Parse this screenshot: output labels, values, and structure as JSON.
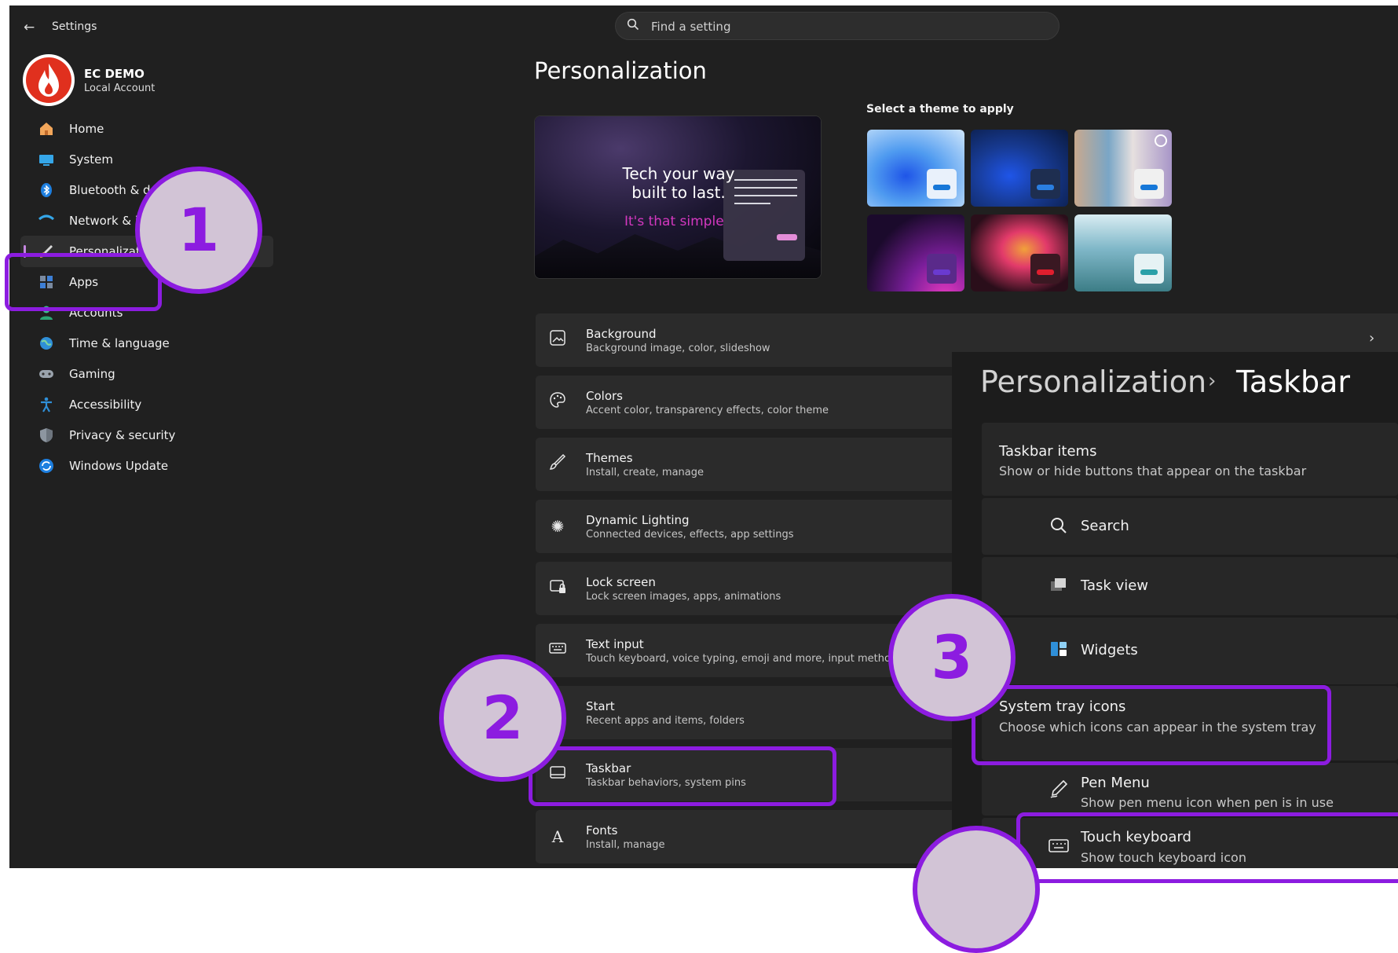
{
  "app": {
    "title": "Settings"
  },
  "search": {
    "placeholder": "Find a setting"
  },
  "account": {
    "name": "EC DEMO",
    "type": "Local Account"
  },
  "sidebar": {
    "items": [
      {
        "label": "Home",
        "icon": "home-icon"
      },
      {
        "label": "System",
        "icon": "display-icon"
      },
      {
        "label": "Bluetooth & d",
        "icon": "bluetooth-icon"
      },
      {
        "label": "Network & inte",
        "icon": "wifi-icon"
      },
      {
        "label": "Personalization",
        "icon": "brush-icon",
        "active": true
      },
      {
        "label": "Apps",
        "icon": "apps-icon"
      },
      {
        "label": "Accounts",
        "icon": "person-icon"
      },
      {
        "label": "Time & language",
        "icon": "globe-clock-icon"
      },
      {
        "label": "Gaming",
        "icon": "gamepad-icon"
      },
      {
        "label": "Accessibility",
        "icon": "accessibility-icon"
      },
      {
        "label": "Privacy & security",
        "icon": "shield-icon"
      },
      {
        "label": "Windows Update",
        "icon": "update-icon"
      }
    ]
  },
  "main": {
    "title": "Personalization",
    "preview": {
      "line1": "Tech your way",
      "line2": "built to last.",
      "line3": "It's that simple"
    },
    "themes_label": "Select a theme to apply",
    "settings": [
      {
        "title": "Background",
        "subtitle": "Background image, color, slideshow",
        "icon": "image-icon"
      },
      {
        "title": "Colors",
        "subtitle": "Accent color, transparency effects, color theme",
        "icon": "palette-icon"
      },
      {
        "title": "Themes",
        "subtitle": "Install, create, manage",
        "icon": "brush-icon"
      },
      {
        "title": "Dynamic Lighting",
        "subtitle": "Connected devices, effects, app settings",
        "icon": "lighting-icon"
      },
      {
        "title": "Lock screen",
        "subtitle": "Lock screen images, apps, animations",
        "icon": "lock-screen-icon"
      },
      {
        "title": "Text input",
        "subtitle": "Touch keyboard, voice typing, emoji and more, input method edi",
        "icon": "keyboard-icon"
      },
      {
        "title": "Start",
        "subtitle": "Recent apps and items, folders",
        "icon": "start-icon"
      },
      {
        "title": "Taskbar",
        "subtitle": "Taskbar behaviors, system pins",
        "icon": "taskbar-icon"
      },
      {
        "title": "Fonts",
        "subtitle": "Install, manage",
        "icon": "fonts-icon"
      }
    ]
  },
  "overlay": {
    "breadcrumb_parent": "Personalization",
    "breadcrumb_separator": "›",
    "breadcrumb_current": "Taskbar",
    "taskbar_items": {
      "title": "Taskbar items",
      "subtitle": "Show or hide buttons that appear on the taskbar"
    },
    "items": [
      {
        "label": "Search",
        "icon": "search-icon"
      },
      {
        "label": "Task view",
        "icon": "task-view-icon"
      },
      {
        "label": "Widgets",
        "icon": "widgets-icon"
      }
    ],
    "system_tray": {
      "title": "System tray icons",
      "subtitle": "Choose which icons can appear in the system tray"
    },
    "pen_menu": {
      "title": "Pen Menu",
      "subtitle": "Show pen menu icon when pen is in use"
    },
    "touch_keyboard": {
      "title": "Touch keyboard",
      "subtitle": "Show touch keyboard icon"
    }
  },
  "callouts": {
    "one": "1",
    "two": "2",
    "three": "3"
  },
  "colors": {
    "accent_highlight": "#8c1ce0",
    "badge_fill": "#d2c4d6",
    "background": "#202020"
  }
}
